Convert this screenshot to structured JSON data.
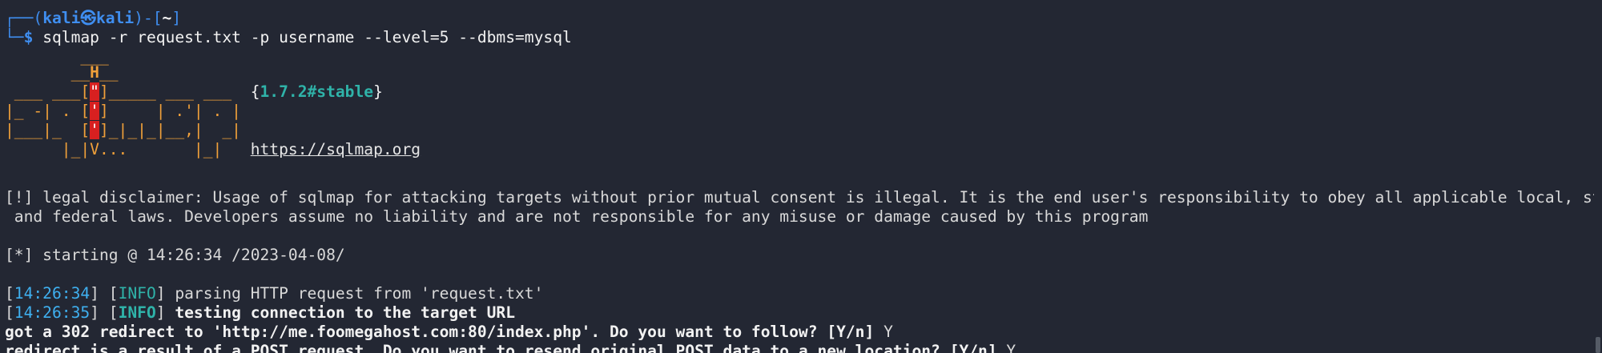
{
  "prompt": {
    "corner_top": "┌──(",
    "user": "kali",
    "at_symbol": "㉿",
    "host": "kali",
    "sep": ")-[",
    "cwd": "~",
    "close": "]",
    "corner_bottom": "└─",
    "dollar": "$",
    "command": "sqlmap -r request.txt -p username --level=5 --dbms=mysql"
  },
  "banner": {
    "line1": "        ___",
    "line2_pre": "       __",
    "line2_h": "H",
    "line2_post": "__",
    "line3_pre": " ___ ___[",
    "line3_mid": "\"",
    "line3_post": "]_____ ___ ___  ",
    "version_open": "{",
    "version": "1.7.2#stable",
    "version_close": "}",
    "line4_pre": "|_ -| . [",
    "line4_mid": "'",
    "line4_post": "]     | .'| . |",
    "line5_pre": "|___|_  [",
    "line5_mid": "'",
    "line5_post": "]_|_|_|__,|  _|",
    "line6": "      |_|V...       |_|   ",
    "url": "https://sqlmap.org"
  },
  "output": {
    "disclaimer_1": "[!] legal disclaimer: Usage of sqlmap for attacking targets without prior mutual consent is illegal. It is the end user's responsibility to obey all applicable local, state",
    "disclaimer_2": " and federal laws. Developers assume no liability and are not responsible for any misuse or damage caused by this program",
    "starting": "[*] starting @ 14:26:34 /2023-04-08/",
    "log1_time": "14:26:34",
    "log1_level": "INFO",
    "log1_msg": " parsing HTTP request from 'request.txt'",
    "log2_time": "14:26:35",
    "log2_level": "INFO",
    "log2_msg": " testing connection to the target URL",
    "redirect_prompt": "got a 302 redirect to 'http://me.foomegahost.com:80/index.php'. Do you want to follow? [Y/n]",
    "redirect_answer": " Y",
    "resend_prompt": "redirect is a result of a POST request. Do you want to resend original POST data to a new location? [Y/n]",
    "resend_answer": " Y"
  },
  "colors": {
    "background": "#232733",
    "prompt_blue": "#3f8ef0",
    "teal": "#2fb3a9",
    "orange": "#f0a03a",
    "red": "#d82020"
  }
}
